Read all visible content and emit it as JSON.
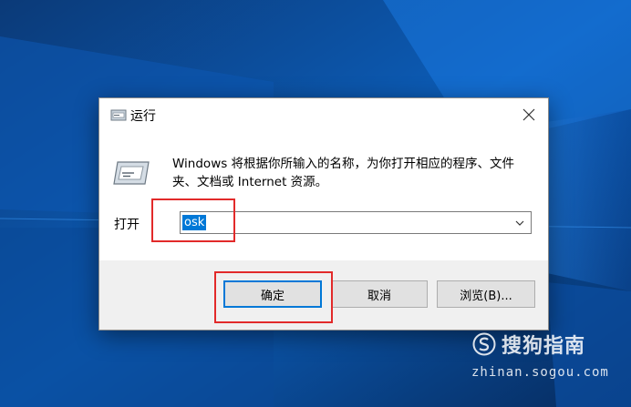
{
  "desktop": {
    "background_color": "#0a3f7e",
    "accent": "#1e90ff"
  },
  "dialog": {
    "title": "运行",
    "title_icon": "run-dialog-icon",
    "close_icon": "close-icon",
    "description": "Windows 将根据你所输入的名称，为你打开相应的程序、文件夹、文档或 Internet 资源。",
    "open_label": "打开",
    "open_value": "osk",
    "chevron_icon": "chevron-down-icon",
    "buttons": {
      "ok": "确定",
      "cancel": "取消",
      "browse": "浏览(B)..."
    }
  },
  "annotations": {
    "highlight_color": "#e22a2a"
  },
  "watermark": {
    "logo_text": "搜狗指南",
    "url": "zhinan.sogou.com"
  }
}
